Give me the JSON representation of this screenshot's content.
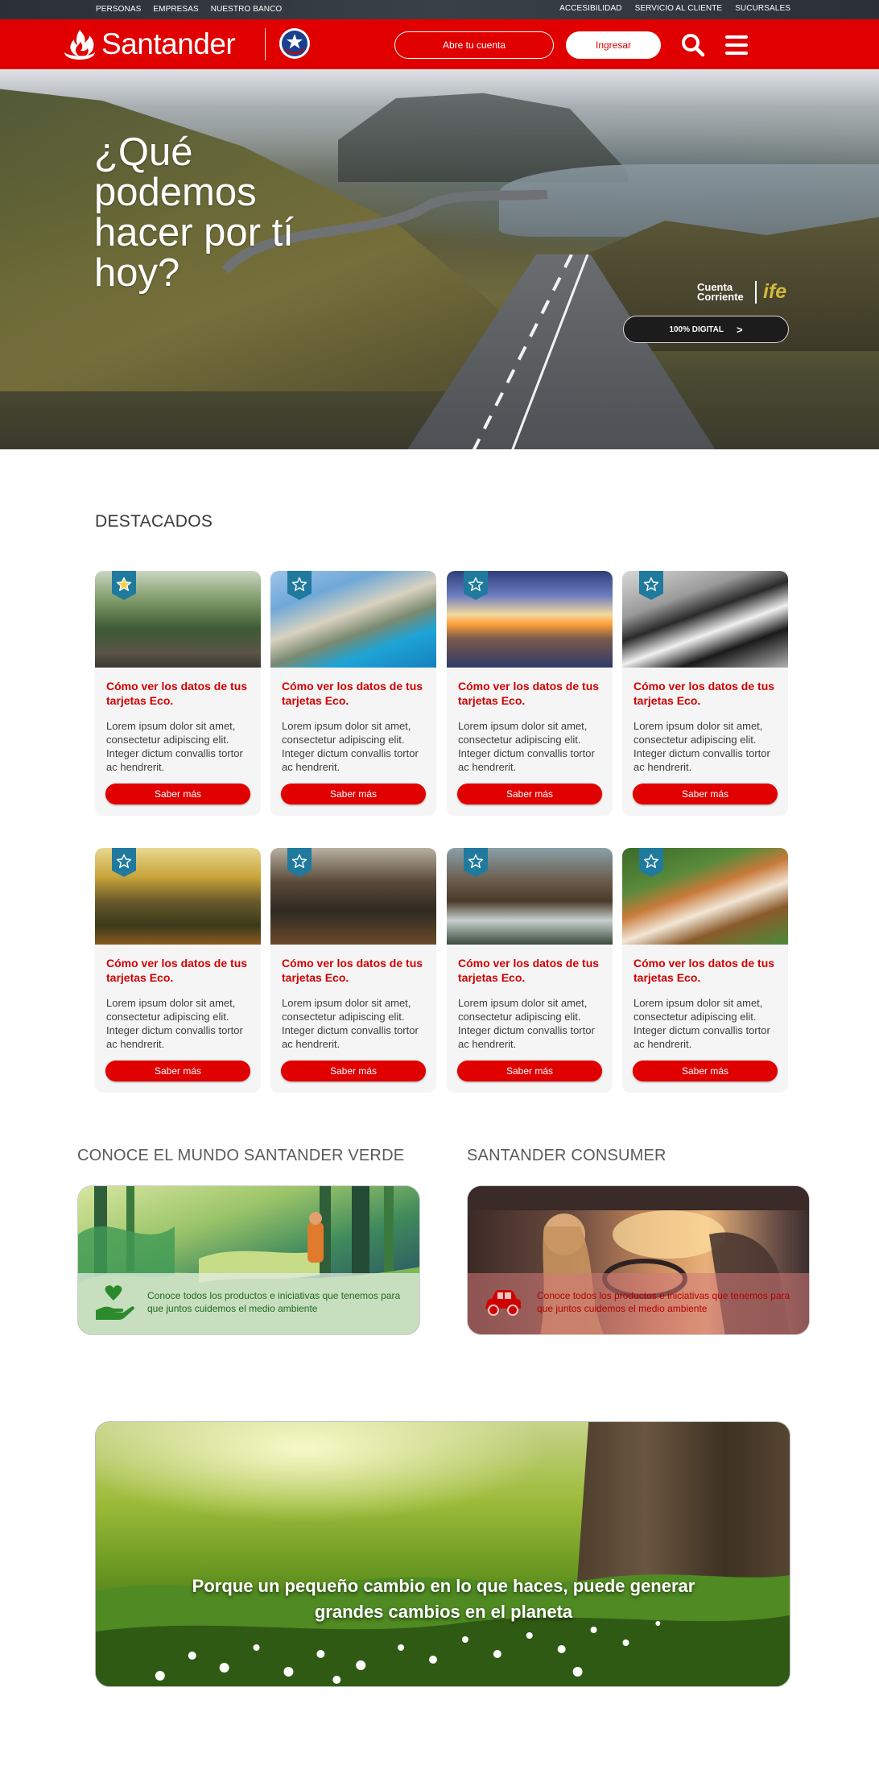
{
  "topbar": {
    "left_links": [
      "PERSONAS",
      "EMPRESAS",
      "NUESTRO BANCO"
    ],
    "right_links": [
      "ACCESIBILIDAD",
      "SERVICIO AL CLIENTE",
      "SUCURSALES"
    ]
  },
  "header": {
    "brand": "Santander",
    "open_account_label": "Abre tu cuenta",
    "login_label": "Ingresar",
    "icons": [
      "flame-logo-icon",
      "chile-seal-icon",
      "search-icon",
      "menu-icon"
    ],
    "brand_color": "#e00000"
  },
  "hero": {
    "title": "¿Qué podemos hacer por tí hoy?",
    "cuenta_corriente": "Cuenta Corriente",
    "ife_label": "ife",
    "digital_button": "100% DIGITAL",
    "digital_chevron": ">"
  },
  "destacados": {
    "title": "DESTACADOS",
    "cards": [
      {
        "title": "Cómo ver los datos de tus tarjetas Eco.",
        "text": "Lorem ipsum dolor sit amet, consectetur adipiscing elit. Integer dictum convallis tortor ac hendrerit.",
        "button": "Saber más",
        "image": "forest-path",
        "starred": true
      },
      {
        "title": "Cómo ver los datos de tus tarjetas Eco.",
        "text": "Lorem ipsum dolor sit amet, consectetur adipiscing elit. Integer dictum convallis tortor ac hendrerit.",
        "button": "Saber más",
        "image": "beach-cove",
        "starred": false
      },
      {
        "title": "Cómo ver los datos de tus tarjetas Eco.",
        "text": "Lorem ipsum dolor sit amet, consectetur adipiscing elit. Integer dictum convallis tortor ac hendrerit.",
        "button": "Saber más",
        "image": "sunset-sea",
        "starred": false
      },
      {
        "title": "Cómo ver los datos de tus tarjetas Eco.",
        "text": "Lorem ipsum dolor sit amet, consectetur adipiscing elit. Integer dictum convallis tortor ac hendrerit.",
        "button": "Saber más",
        "image": "border-collie",
        "starred": false
      },
      {
        "title": "Cómo ver los datos de tus tarjetas Eco.",
        "text": "Lorem ipsum dolor sit amet, consectetur adipiscing elit. Integer dictum convallis tortor ac hendrerit.",
        "button": "Saber más",
        "image": "autumn-forest",
        "starred": false
      },
      {
        "title": "Cómo ver los datos de tus tarjetas Eco.",
        "text": "Lorem ipsum dolor sit amet, consectetur adipiscing elit. Integer dictum convallis tortor ac hendrerit.",
        "button": "Saber más",
        "image": "dark-forest",
        "starred": false
      },
      {
        "title": "Cómo ver los datos de tus tarjetas Eco.",
        "text": "Lorem ipsum dolor sit amet, consectetur adipiscing elit. Integer dictum convallis tortor ac hendrerit.",
        "button": "Saber más",
        "image": "water-mill",
        "starred": false
      },
      {
        "title": "Cómo ver los datos de tus tarjetas Eco.",
        "text": "Lorem ipsum dolor sit amet, consectetur adipiscing elit. Integer dictum convallis tortor ac hendrerit.",
        "button": "Saber más",
        "image": "beagle-dog",
        "starred": false
      }
    ]
  },
  "verde": {
    "title": "CONOCE EL MUNDO SANTANDER VERDE",
    "text": "Conoce todos los productos e iniciativas que tenemos para que juntos cuidemos el medio ambiente",
    "icon": "heart-hand-icon"
  },
  "consumer": {
    "title": "SANTANDER CONSUMER",
    "text": "Conoce todos los productos e iniciativas que tenemos para que juntos cuidemos el medio ambiente",
    "icon": "car-icon"
  },
  "banner": {
    "text": "Porque un pequeño cambio en lo que haces, puede generar grandes cambios en el planeta"
  }
}
